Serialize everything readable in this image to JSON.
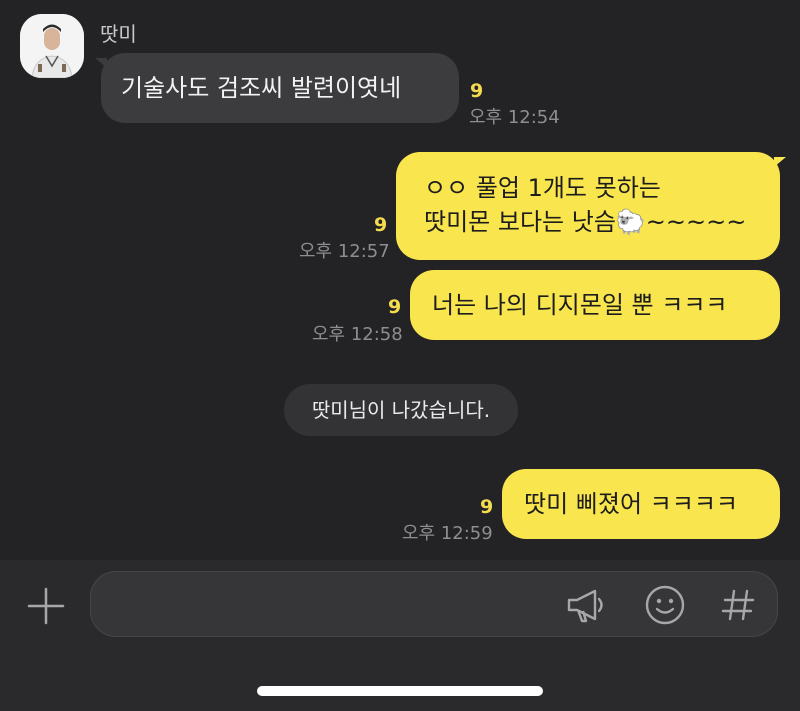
{
  "sender": {
    "name": "땃미"
  },
  "messages": [
    {
      "direction": "in",
      "text": "기술사도 검조씨 발련이엿네",
      "unread": "9",
      "time": "오후 12:54"
    },
    {
      "direction": "out",
      "lines": [
        "ㅇㅇ 풀업 1개도 못하는",
        "땃미몬 보다는 낫슴🐑~~~~~"
      ],
      "unread": "9",
      "time": "오후 12:57"
    },
    {
      "direction": "out",
      "text": "너는 나의 디지몬일 뿐 ㅋㅋㅋ",
      "unread": "9",
      "time": "오후 12:58"
    },
    {
      "direction": "out",
      "text": "땃미 삐졌어 ㅋㅋㅋㅋ",
      "unread": "9",
      "time": "오후 12:59"
    }
  ],
  "system_notice": "땃미님이 나갔습니다.",
  "input_bar": {
    "placeholder": "",
    "icons": [
      "plus-icon",
      "megaphone-icon",
      "emoji-icon",
      "hashtag-icon"
    ]
  },
  "colors": {
    "background": "#232325",
    "outgoing_bubble": "#f9e54d",
    "incoming_bubble": "#3c3c3f",
    "unread": "#f4dc4e"
  }
}
